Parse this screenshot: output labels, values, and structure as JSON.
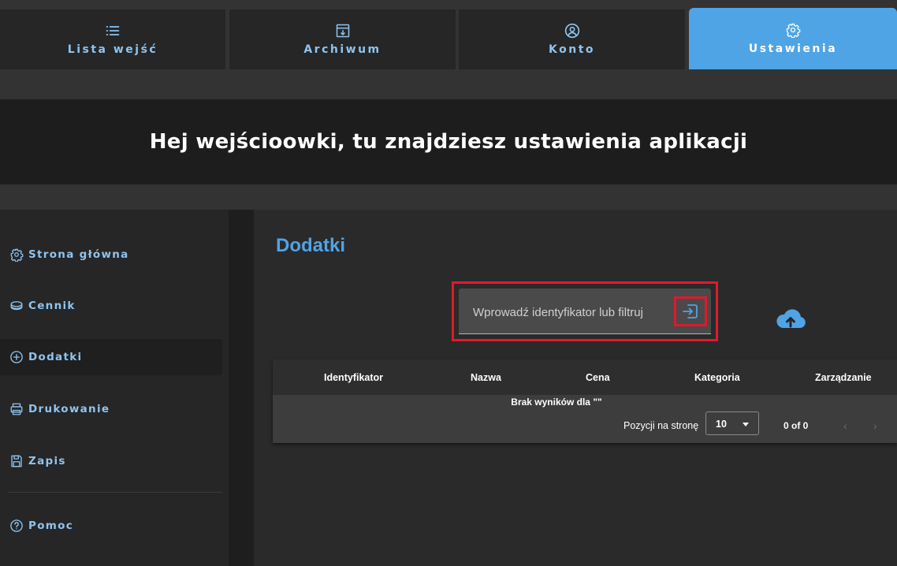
{
  "tabs": [
    {
      "label": "Lista wejść",
      "icon": "list-icon",
      "active": false
    },
    {
      "label": "Archiwum",
      "icon": "archive-icon",
      "active": false
    },
    {
      "label": "Konto",
      "icon": "account-icon",
      "active": false
    },
    {
      "label": "Ustawienia",
      "icon": "settings-gear-icon",
      "active": true
    }
  ],
  "header": {
    "title": "Hej wejścioowki, tu znajdziesz ustawienia aplikacji"
  },
  "sidebar": {
    "items": [
      {
        "label": "Strona główna",
        "icon": "gear-icon",
        "active": false
      },
      {
        "label": "Cennik",
        "icon": "coins-icon",
        "active": false
      },
      {
        "label": "Dodatki",
        "icon": "plus-circle-icon",
        "active": true
      },
      {
        "label": "Drukowanie",
        "icon": "printer-icon",
        "active": false
      },
      {
        "label": "Zapis",
        "icon": "save-icon",
        "active": false
      },
      {
        "label": "Pomoc",
        "icon": "help-icon",
        "active": false
      }
    ]
  },
  "main": {
    "title": "Dodatki",
    "search": {
      "placeholder": "Wprowadź identyfikator lub filtruj",
      "value": ""
    },
    "table": {
      "columns": [
        "Identyfikator",
        "Nazwa",
        "Cena",
        "Kategoria",
        "Zarządzanie"
      ],
      "rows": [],
      "empty_text": "Brak wyników dla \"\""
    },
    "pagination": {
      "label": "Pozycji na stronę",
      "page_size": "10",
      "range": "0 of 0",
      "prev": "‹",
      "next": "›"
    }
  },
  "colors": {
    "accent": "#4fa4e6",
    "highlight": "#e0192c",
    "tab_text": "#8ec4f0"
  }
}
